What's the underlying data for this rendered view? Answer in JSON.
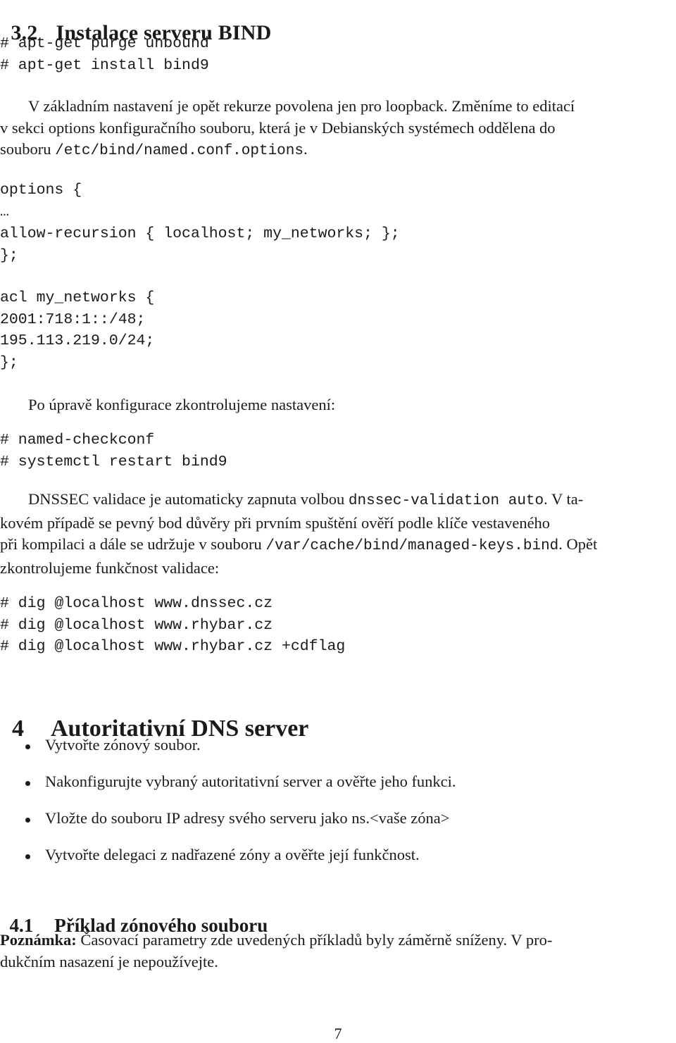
{
  "section_3_2": {
    "number": "3.2",
    "title": "Instalace serveru BIND",
    "install_commands": [
      "# apt-get purge unbound",
      "# apt-get install bind9"
    ],
    "intro_paragraph": {
      "line1": "V základním nastavení je opět rekurze povolena jen pro loopback. Změníme to editací",
      "line2": "v sekci options konfiguračního souboru, která je v Debianských systémech oddělena do",
      "line3_prefix": "souboru ",
      "line3_path": "/etc/bind/named.conf.options",
      "line3_suffix": "."
    },
    "config_block": [
      "options {",
      "…",
      "allow-recursion { localhost; my_networks; };",
      "};",
      "",
      "acl my_networks {",
      "2001:718:1::/48;",
      "195.113.219.0/24;",
      "};"
    ],
    "check_paragraph": "Po úpravě konfigurace zkontrolujeme nastavení:",
    "check_commands": [
      "# named-checkconf",
      "# systemctl restart bind9"
    ],
    "dnssec_paragraph": {
      "line1_prefix": "DNSSEC validace je automaticky zapnuta volbou ",
      "line1_code": "dnssec-validation auto",
      "line1_suffix": ". V ta-",
      "line2": "kovém případě se pevný bod důvěry při prvním spuštění ověří podle klíče vestaveného",
      "line3_prefix": "při kompilaci a dále se udržuje v souboru ",
      "line3_path": "/var/cache/bind/managed-keys.bind",
      "line3_suffix": ". Opět",
      "line4": "zkontrolujeme funkčnost validace:"
    },
    "dig_commands": [
      "# dig @localhost www.dnssec.cz",
      "# dig @localhost www.rhybar.cz",
      "# dig @localhost www.rhybar.cz +cdflag"
    ]
  },
  "section_4": {
    "number": "4",
    "title": "Autoritativní DNS server",
    "bullets": [
      "Vytvořte zónový soubor.",
      "Nakonfigurujte vybraný autoritativní server a ověřte jeho funkci.",
      "Vložte do souboru IP adresy svého serveru jako ns.<vaše zóna>",
      "Vytvořte delegaci z nadřazené zóny a ověřte její funkčnost."
    ]
  },
  "section_4_1": {
    "number": "4.1",
    "title": "Příklad zónového souboru",
    "note_label": "Poznámka:",
    "note_line1": " Časovací parametry zde uvedených příkladů byly záměrně sníženy. V pro-",
    "note_line2": "dukčním nasazení je nepoužívejte."
  },
  "page_number": "7"
}
